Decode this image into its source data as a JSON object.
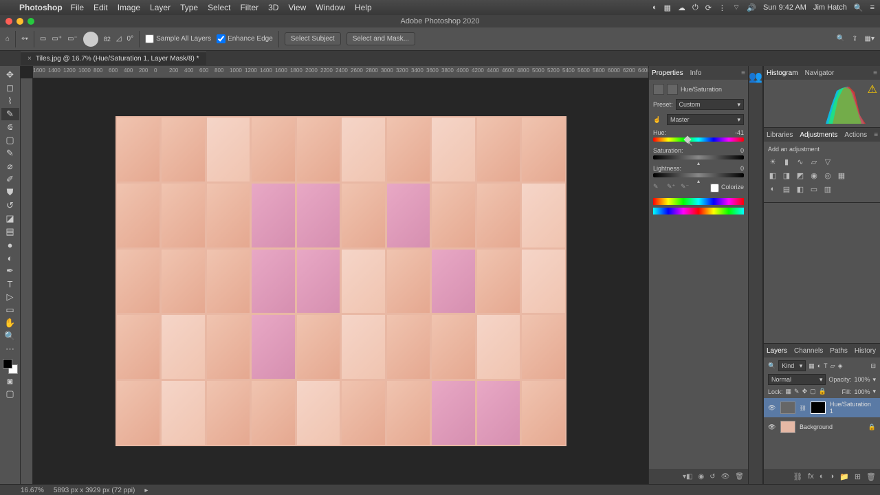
{
  "menubar": {
    "app": "Photoshop",
    "items": [
      "File",
      "Edit",
      "Image",
      "Layer",
      "Type",
      "Select",
      "Filter",
      "3D",
      "View",
      "Window",
      "Help"
    ],
    "clock": "Sun 9:42 AM",
    "user": "Jim Hatch"
  },
  "window": {
    "title": "Adobe Photoshop 2020"
  },
  "options_bar": {
    "brush_size": "82",
    "degree": "0°",
    "sample_all": "Sample All Layers",
    "enhance": "Enhance Edge",
    "select_subject": "Select Subject",
    "select_mask": "Select and Mask..."
  },
  "doc_tab": {
    "label": "Tiles.jpg @ 16.7% (Hue/Saturation 1, Layer Mask/8) *"
  },
  "ruler_ticks": [
    "1600",
    "1400",
    "1200",
    "1000",
    "800",
    "600",
    "400",
    "200",
    "0",
    "200",
    "400",
    "600",
    "800",
    "1000",
    "1200",
    "1400",
    "1600",
    "1800",
    "2000",
    "2200",
    "2400",
    "2600",
    "2800",
    "3000",
    "3200",
    "3400",
    "3600",
    "3800",
    "4000",
    "4200",
    "4400",
    "4600",
    "4800",
    "5000",
    "5200",
    "5400",
    "5600",
    "5800",
    "6000",
    "6200",
    "6400"
  ],
  "properties": {
    "tab1": "Properties",
    "tab2": "Info",
    "title": "Hue/Saturation",
    "preset_label": "Preset:",
    "preset_value": "Custom",
    "channel_value": "Master",
    "hue_label": "Hue:",
    "hue_value": "-41",
    "sat_label": "Saturation:",
    "sat_value": "0",
    "light_label": "Lightness:",
    "light_value": "0",
    "colorize": "Colorize"
  },
  "histogram": {
    "tab1": "Histogram",
    "tab2": "Navigator"
  },
  "adjustments": {
    "tab1": "Libraries",
    "tab2": "Adjustments",
    "tab3": "Actions",
    "hint": "Add an adjustment"
  },
  "layers": {
    "tabs": [
      "Layers",
      "Channels",
      "Paths",
      "History"
    ],
    "kind": "Kind",
    "blend": "Normal",
    "opacity_label": "Opacity:",
    "opacity": "100%",
    "lock_label": "Lock:",
    "fill_label": "Fill:",
    "fill": "100%",
    "items": [
      {
        "name": "Hue/Saturation 1"
      },
      {
        "name": "Background"
      }
    ]
  },
  "status": {
    "zoom": "16.67%",
    "dims": "5893 px x 3929 px (72 ppi)"
  }
}
